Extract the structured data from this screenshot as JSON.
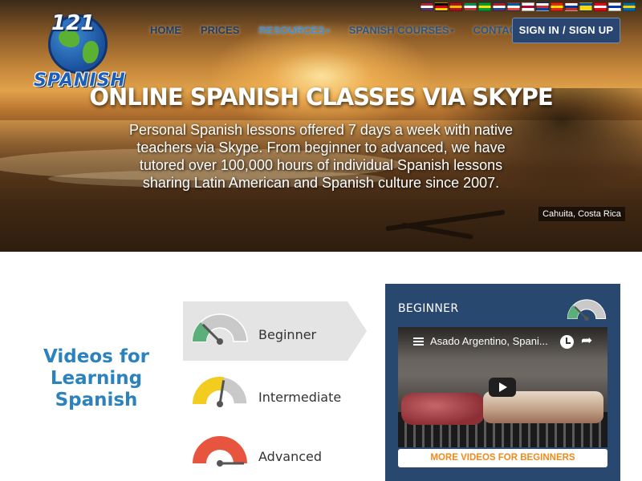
{
  "logo": {
    "number": "121",
    "word": "SPANISH"
  },
  "flags": [
    {
      "name": "us-flag-icon",
      "colors": [
        "#b22234",
        "#ffffff",
        "#3c3b6e"
      ]
    },
    {
      "name": "de-flag-icon",
      "colors": [
        "#000000",
        "#dd0000",
        "#ffce00"
      ]
    },
    {
      "name": "es-flag-icon",
      "colors": [
        "#aa151b",
        "#f1bf00",
        "#aa151b"
      ]
    },
    {
      "name": "it-flag-icon",
      "colors": [
        "#009246",
        "#ffffff",
        "#ce2b37"
      ]
    },
    {
      "name": "br-flag-icon",
      "colors": [
        "#009c3b",
        "#ffdf00",
        "#009c3b"
      ]
    },
    {
      "name": "nl-flag-icon",
      "colors": [
        "#ae1c28",
        "#ffffff",
        "#21468b"
      ]
    },
    {
      "name": "fr-flag-icon",
      "colors": [
        "#0055a4",
        "#ffffff",
        "#ef4135"
      ]
    },
    {
      "name": "jp-flag-icon",
      "colors": [
        "#ffffff",
        "#bc002d",
        "#ffffff"
      ]
    },
    {
      "name": "kr-flag-icon",
      "colors": [
        "#ffffff",
        "#cd2e3a",
        "#0047a0"
      ]
    },
    {
      "name": "cn-flag-icon",
      "colors": [
        "#de2910",
        "#ffde00",
        "#de2910"
      ]
    },
    {
      "name": "ru-flag-icon",
      "colors": [
        "#ffffff",
        "#0039a6",
        "#d52b1e"
      ]
    },
    {
      "name": "ua-flag-icon",
      "colors": [
        "#0057b7",
        "#ffd700",
        "#ffd700"
      ]
    },
    {
      "name": "tr-flag-icon",
      "colors": [
        "#e30a17",
        "#ffffff",
        "#e30a17"
      ]
    },
    {
      "name": "il-flag-icon",
      "colors": [
        "#ffffff",
        "#0038b8",
        "#ffffff"
      ]
    },
    {
      "name": "se-flag-icon",
      "colors": [
        "#006aa7",
        "#fecc00",
        "#006aa7"
      ]
    }
  ],
  "nav": {
    "home": "HOME",
    "prices": "PRICES",
    "resources": "RESOURCES",
    "spanish_courses": "SPANISH COURSES",
    "contact": "CONTACT",
    "signin": "SIGN IN / SIGN UP"
  },
  "hero": {
    "title": "ONLINE SPANISH CLASSES VIA SKYPE",
    "subtitle": "Personal Spanish lessons offered 7 days a week with native teachers via Skype. From beginner to advanced, we have tutored over 100,000 hours of individual Spanish lessons sharing Latin American and Spanish culture since 2007.",
    "caption": "Cahuita, Costa Rica"
  },
  "videos": {
    "title": "Videos for Learning Spanish",
    "levels": [
      {
        "label": "Beginner",
        "color": "#5cae7a",
        "level": 0.25
      },
      {
        "label": "Intermediate",
        "color": "#f2cc1f",
        "level": 0.55
      },
      {
        "label": "Advanced",
        "color": "#e8553e",
        "level": 1.0
      }
    ]
  },
  "panel": {
    "title": "BEGINNER",
    "video_title": "Asado Argentino, Spani...",
    "more_button": "MORE VIDEOS FOR BEGINNERS"
  },
  "colors": {
    "nav_text": "#1e3f66",
    "nav_active": "#3e8fd8",
    "panel_bg": "#29486f",
    "accent_orange": "#f08a1c",
    "heading_blue": "#2b82bd"
  }
}
